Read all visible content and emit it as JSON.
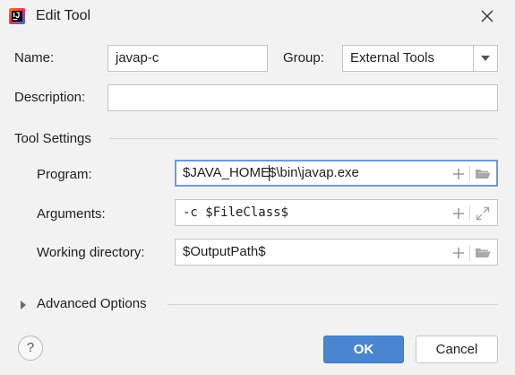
{
  "window": {
    "title": "Edit Tool",
    "app_icon": "intellij-idea-icon",
    "close_icon": "close-icon"
  },
  "form": {
    "name_label": "Name:",
    "name_value": "javap-c",
    "group_label": "Group:",
    "group_value": "External Tools",
    "description_label": "Description:",
    "description_value": ""
  },
  "tool_settings": {
    "section_label": "Tool Settings",
    "program_label": "Program:",
    "program_value_before_caret": "$JAVA_HOME",
    "program_value_after_caret": "$\\bin\\javap.exe",
    "arguments_label": "Arguments:",
    "arguments_value": "-c $FileClass$",
    "working_dir_label": "Working directory:",
    "working_dir_value": "$OutputPath$"
  },
  "advanced": {
    "label": "Advanced Options",
    "expanded": false
  },
  "buttons": {
    "help": "?",
    "ok": "OK",
    "cancel": "Cancel"
  },
  "colors": {
    "background": "#f2f2f2",
    "accent": "#4a86d0",
    "focus_border": "#6c9bd8"
  }
}
